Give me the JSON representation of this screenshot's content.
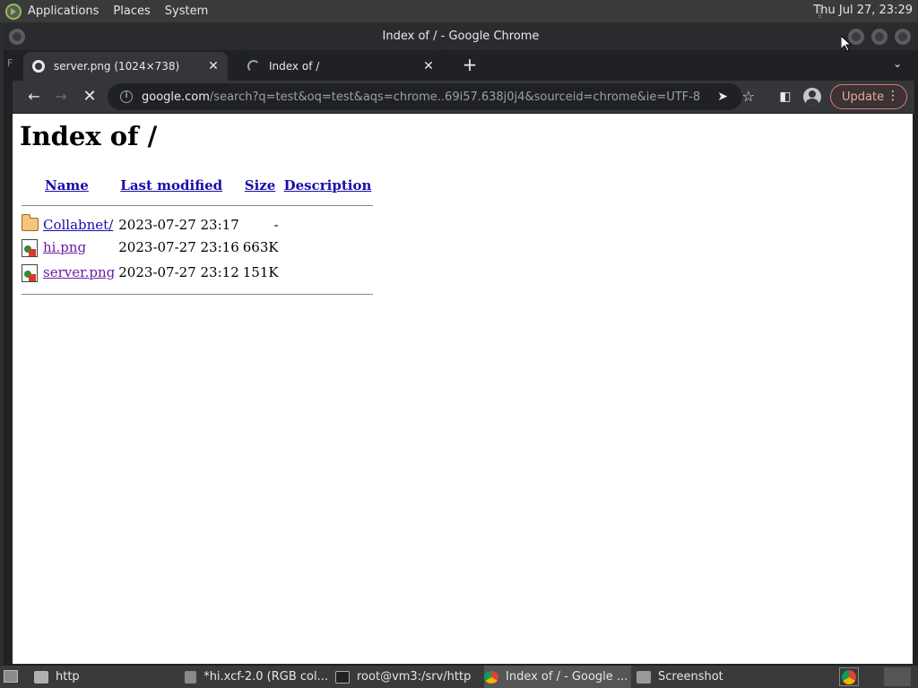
{
  "top_panel": {
    "menus": [
      "Applications",
      "Places",
      "System"
    ],
    "clock": "Thu Jul 27, 23:29"
  },
  "window": {
    "title": "Index of / - Google Chrome"
  },
  "tabs": [
    {
      "title": "server.png (1024×738)",
      "close": "✕"
    },
    {
      "title": "Index of /",
      "close": "✕"
    }
  ],
  "toolbar": {
    "url_host": "google.com",
    "url_path": "/search?q=test&oq=test&aqs=chrome..69i57.638j0j4&sourceid=chrome&ie=UTF-8",
    "update_label": "Update"
  },
  "page": {
    "heading": "Index of /",
    "columns": [
      "Name",
      "Last modified",
      "Size",
      "Description"
    ],
    "rows": [
      {
        "icon": "folder-icon",
        "name": "Collabnet/",
        "modified": "2023-07-27 23:17",
        "size": "-",
        "description": ""
      },
      {
        "icon": "image-icon",
        "name": "hi.png",
        "modified": "2023-07-27 23:16",
        "size": "663K",
        "description": ""
      },
      {
        "icon": "image-icon",
        "name": "server.png",
        "modified": "2023-07-27 23:12",
        "size": "151K",
        "description": ""
      }
    ]
  },
  "taskbar": {
    "items": [
      "http",
      "*hi.xcf-2.0 (RGB col...",
      "root@vm3:/srv/http",
      "Index of / - Google ...",
      "Screenshot"
    ]
  },
  "colors": {
    "link": "#1a0dab",
    "visited_link": "#681da8",
    "update_accent": "#d77c73"
  }
}
